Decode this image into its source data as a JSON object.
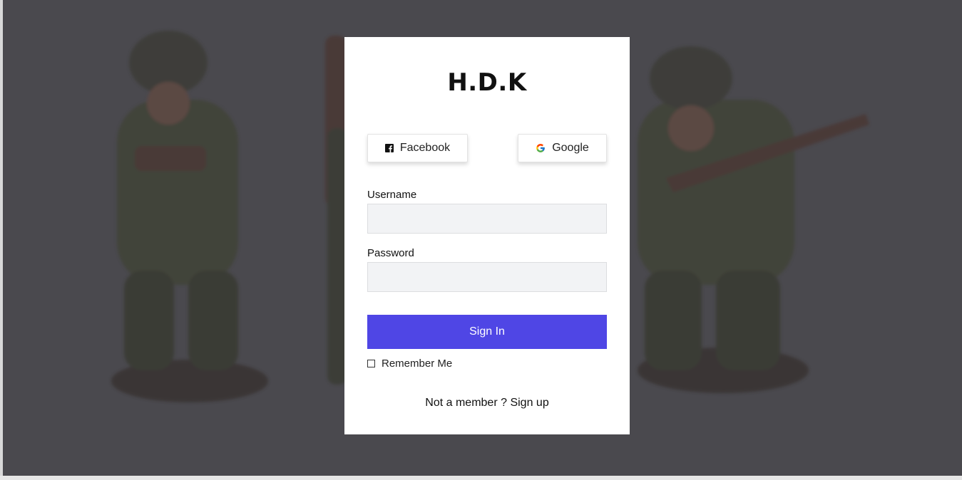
{
  "brand": "H.D.K",
  "social": {
    "facebook_label": "Facebook",
    "google_label": "Google"
  },
  "form": {
    "username_label": "Username",
    "username_value": "",
    "password_label": "Password",
    "password_value": "",
    "signin_label": "Sign In",
    "remember_label": "Remember Me"
  },
  "footer": {
    "prompt": "Not a member ?",
    "signup_link": "Sign up"
  },
  "colors": {
    "primary": "#4f46e5",
    "overlay": "#4a494e",
    "input_bg": "#f2f3f5"
  },
  "icons": {
    "facebook": "facebook-icon",
    "google": "google-icon"
  }
}
